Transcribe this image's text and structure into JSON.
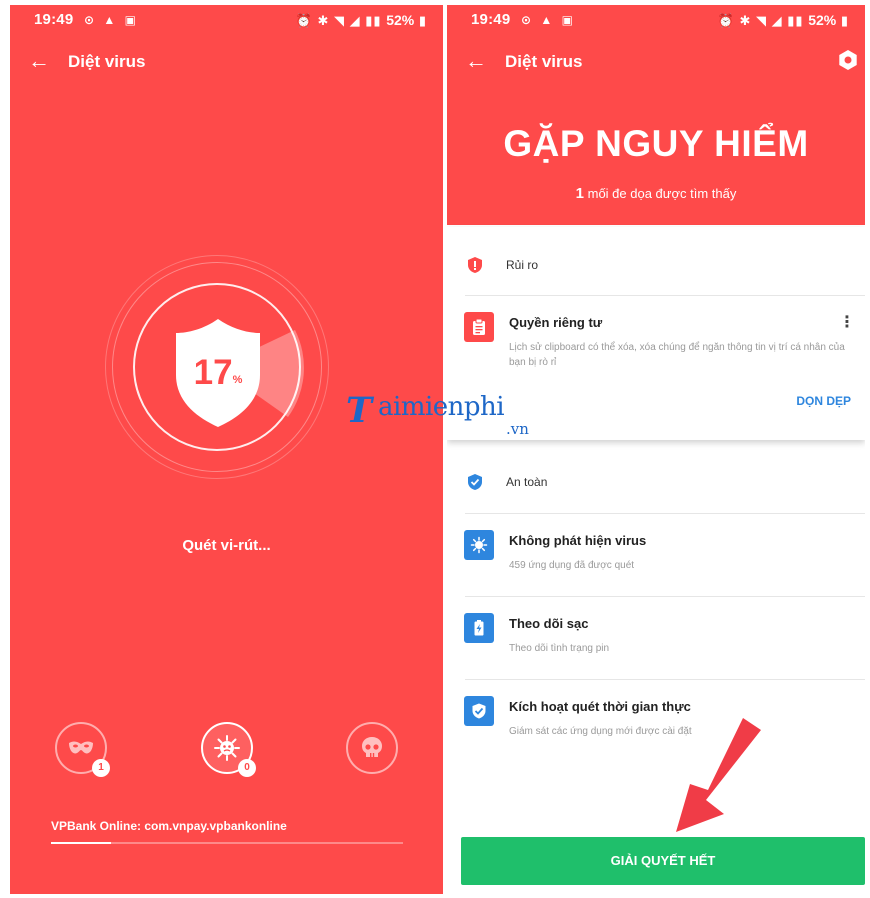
{
  "left_screen": {
    "status": {
      "time": "19:49",
      "battery": "52%"
    },
    "appbar": {
      "title": "Diệt virus"
    },
    "scan": {
      "percent": "17",
      "unit": "%",
      "label": "Quét vi-rút..."
    },
    "categories": [
      {
        "name": "mask-icon",
        "count": "1"
      },
      {
        "name": "virus-icon",
        "count": "0"
      },
      {
        "name": "skull-icon",
        "count": ""
      }
    ],
    "current_item": "VPBank Online: com.vnpay.vpbankonline",
    "progress": 0.17
  },
  "right_screen": {
    "status": {
      "time": "19:49",
      "battery": "52%"
    },
    "appbar": {
      "title": "Diệt virus"
    },
    "header": {
      "headline": "GẶP NGUY HIỂM",
      "threat_count": "1",
      "threat_text": "mối đe dọa được tìm thấy"
    },
    "risk_section": {
      "label": "Rủi ro",
      "item": {
        "title": "Quyền riêng tư",
        "description": "Lịch sử clipboard có thể xóa, xóa chúng để ngăn thông tin vị trí cá nhân của bạn bị rò rỉ",
        "action": "DỌN DẸP"
      }
    },
    "safe_section": {
      "label": "An toàn",
      "items": [
        {
          "title": "Không phát hiện virus",
          "description": "459 ứng dụng đã được quét"
        },
        {
          "title": "Theo dõi sạc",
          "description": "Theo dõi tình trạng pin"
        },
        {
          "title": "Kích hoạt quét thời gian thực",
          "description": "Giám sát các ứng dụng mới được cài đặt"
        }
      ]
    },
    "resolve_button": "GIẢI QUYẾT HẾT"
  },
  "watermark": {
    "logo": "T",
    "text": "aimienphi",
    "sub": ".vn"
  },
  "colors": {
    "primary_red": "#fe4a4a",
    "action_blue": "#2e86de",
    "resolve_green": "#1fbf6b",
    "arrow_red": "#f03c47",
    "watermark_blue": "#1e67c7"
  }
}
